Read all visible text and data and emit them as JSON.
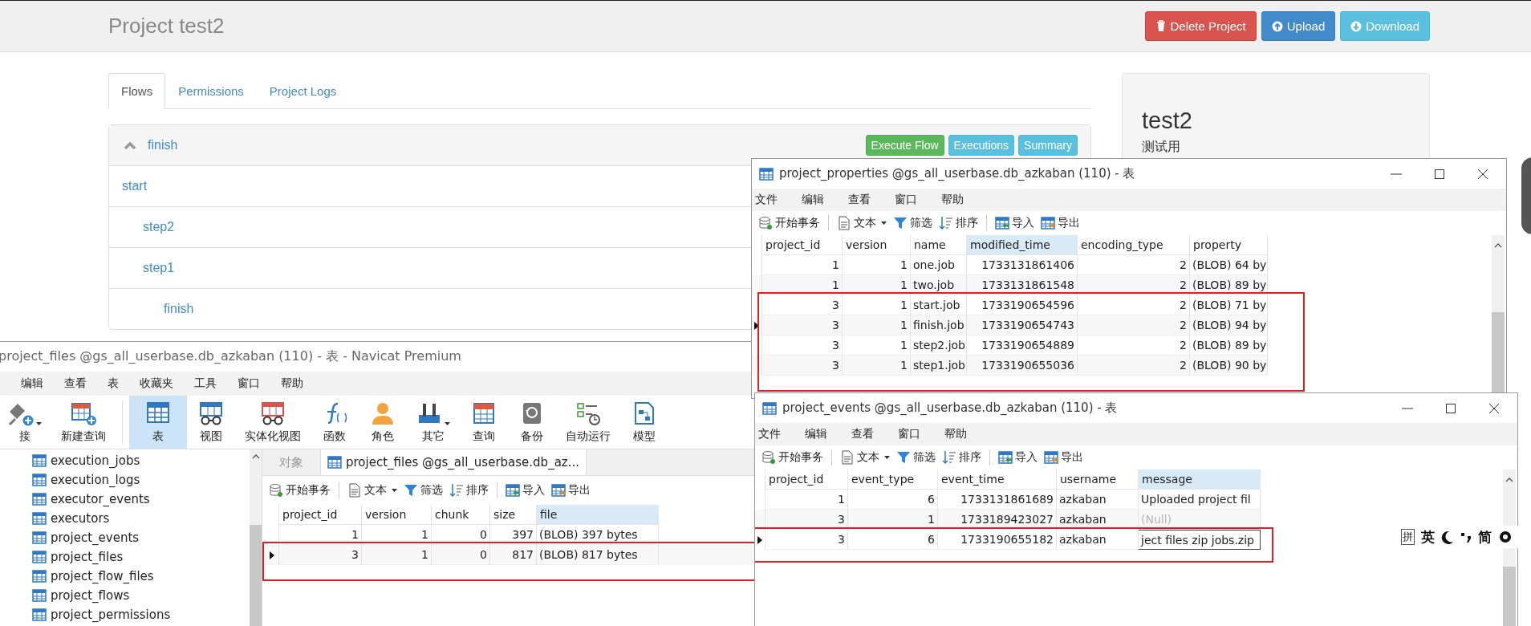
{
  "azkaban": {
    "title": "Project test2",
    "header_buttons": [
      {
        "label": "Delete Project",
        "kind": "danger"
      },
      {
        "label": "Upload",
        "kind": "primary"
      },
      {
        "label": "Download",
        "kind": "info"
      }
    ],
    "tabs": [
      {
        "label": "Flows",
        "selected": true
      },
      {
        "label": "Permissions",
        "selected": false
      },
      {
        "label": "Project Logs",
        "selected": false
      }
    ],
    "flow": {
      "name": "finish",
      "expanded": true,
      "buttons": [
        {
          "label": "Execute Flow",
          "kind": "success"
        },
        {
          "label": "Executions",
          "kind": "info"
        },
        {
          "label": "Summary",
          "kind": "info"
        }
      ],
      "nodes": [
        {
          "label": "start",
          "children": [
            {
              "label": "step2"
            },
            {
              "label": "step1",
              "children": [
                {
                  "label": "finish"
                }
              ]
            }
          ]
        }
      ]
    },
    "project_panel": {
      "name": "test2",
      "description": "测试用"
    }
  },
  "navicat_window": {
    "title": "project_files @gs_all_userbase.db_azkaban (110) - 表 - Navicat Premium",
    "menu": [
      "编辑",
      "查看",
      "表",
      "收藏夹",
      "工具",
      "窗口",
      "帮助"
    ],
    "toolbar": [
      {
        "label": "接",
        "kind": "connect",
        "selected": false,
        "dropdown": true
      },
      {
        "label": "新建查询",
        "kind": "newquery",
        "selected": false,
        "dropdown": false
      },
      {
        "label": "表",
        "kind": "table",
        "selected": true,
        "dropdown": false
      },
      {
        "label": "视图",
        "kind": "view",
        "selected": false,
        "dropdown": false
      },
      {
        "label": "实体化视图",
        "kind": "matview",
        "selected": false,
        "dropdown": false
      },
      {
        "label": "函数",
        "kind": "function",
        "selected": false,
        "dropdown": false
      },
      {
        "label": "角色",
        "kind": "user",
        "selected": false,
        "dropdown": false
      },
      {
        "label": "其它",
        "kind": "other",
        "selected": false,
        "dropdown": true
      },
      {
        "label": "查询",
        "kind": "query",
        "selected": false,
        "dropdown": false
      },
      {
        "label": "备份",
        "kind": "backup",
        "selected": false,
        "dropdown": false
      },
      {
        "label": "自动运行",
        "kind": "schedule",
        "selected": false,
        "dropdown": false
      },
      {
        "label": "模型",
        "kind": "model",
        "selected": false,
        "dropdown": false
      }
    ],
    "tree": [
      "execution_jobs",
      "execution_logs",
      "executor_events",
      "executors",
      "project_events",
      "project_files",
      "project_flow_files",
      "project_flows",
      "project_permissions"
    ],
    "tabs": [
      {
        "label": "对象",
        "selected": false
      },
      {
        "label": "project_files @gs_all_userbase.db_az...",
        "selected": true
      }
    ],
    "actions": [
      {
        "label": "开始事务",
        "kind": "begin",
        "dropdown": false
      },
      {
        "label": "文本",
        "kind": "text",
        "dropdown": true
      },
      {
        "label": "筛选",
        "kind": "filter",
        "dropdown": false
      },
      {
        "label": "排序",
        "kind": "sort",
        "dropdown": false
      },
      {
        "label": "导入",
        "kind": "import",
        "dropdown": false
      },
      {
        "label": "导出",
        "kind": "export",
        "dropdown": false
      }
    ],
    "columns": [
      {
        "label": "project_id",
        "kind": "number",
        "highlighted": false
      },
      {
        "label": "version",
        "kind": "number",
        "highlighted": false
      },
      {
        "label": "chunk",
        "kind": "number",
        "highlighted": false
      },
      {
        "label": "size",
        "kind": "number",
        "highlighted": false
      },
      {
        "label": "file",
        "kind": "text",
        "highlighted": true
      }
    ],
    "rows": [
      {
        "cells": [
          "1",
          "1",
          "0",
          "397",
          "(BLOB) 397 bytes"
        ],
        "selected": false,
        "outlined": false
      },
      {
        "cells": [
          "3",
          "1",
          "0",
          "817",
          "(BLOB) 817 bytes"
        ],
        "selected": true,
        "outlined": true
      }
    ]
  },
  "properties_window": {
    "title": "project_properties @gs_all_userbase.db_azkaban (110) - 表",
    "menu": [
      "文件",
      "编辑",
      "查看",
      "窗口",
      "帮助"
    ],
    "actions": [
      {
        "label": "开始事务",
        "kind": "begin",
        "dropdown": false
      },
      {
        "label": "文本",
        "kind": "text",
        "dropdown": true
      },
      {
        "label": "筛选",
        "kind": "filter",
        "dropdown": false
      },
      {
        "label": "排序",
        "kind": "sort",
        "dropdown": false
      },
      {
        "label": "导入",
        "kind": "import",
        "dropdown": false
      },
      {
        "label": "导出",
        "kind": "export",
        "dropdown": false
      }
    ],
    "columns": [
      {
        "label": "project_id",
        "kind": "number",
        "highlighted": false
      },
      {
        "label": "version",
        "kind": "number",
        "highlighted": false
      },
      {
        "label": "name",
        "kind": "text",
        "highlighted": false
      },
      {
        "label": "modified_time",
        "kind": "number",
        "highlighted": true
      },
      {
        "label": "encoding_type",
        "kind": "number",
        "highlighted": false
      },
      {
        "label": "property",
        "kind": "text",
        "highlighted": false
      }
    ],
    "rows": [
      {
        "cells": [
          "1",
          "1",
          "one.job",
          "1733131861406",
          "2",
          "(BLOB) 64 by"
        ],
        "selected": false,
        "outlined": false
      },
      {
        "cells": [
          "1",
          "1",
          "two.job",
          "1733131861548",
          "2",
          "(BLOB) 89 by"
        ],
        "selected": false,
        "outlined": false
      },
      {
        "cells": [
          "3",
          "1",
          "start.job",
          "1733190654596",
          "2",
          "(BLOB) 71 by"
        ],
        "selected": false,
        "outlined": true
      },
      {
        "cells": [
          "3",
          "1",
          "finish.job",
          "1733190654743",
          "2",
          "(BLOB) 94 by"
        ],
        "selected": true,
        "outlined": true
      },
      {
        "cells": [
          "3",
          "1",
          "step2.job",
          "1733190654889",
          "2",
          "(BLOB) 89 by"
        ],
        "selected": false,
        "outlined": true
      },
      {
        "cells": [
          "3",
          "1",
          "step1.job",
          "1733190655036",
          "2",
          "(BLOB) 90 by"
        ],
        "selected": false,
        "outlined": true
      }
    ]
  },
  "events_window": {
    "title": "project_events @gs_all_userbase.db_azkaban (110) - 表",
    "menu": [
      "文件",
      "编辑",
      "查看",
      "窗口",
      "帮助"
    ],
    "actions": [
      {
        "label": "开始事务",
        "kind": "begin",
        "dropdown": false
      },
      {
        "label": "文本",
        "kind": "text",
        "dropdown": true
      },
      {
        "label": "筛选",
        "kind": "filter",
        "dropdown": false
      },
      {
        "label": "排序",
        "kind": "sort",
        "dropdown": false
      },
      {
        "label": "导入",
        "kind": "import",
        "dropdown": false
      },
      {
        "label": "导出",
        "kind": "export",
        "dropdown": false
      }
    ],
    "columns": [
      {
        "label": "project_id",
        "kind": "number",
        "highlighted": false
      },
      {
        "label": "event_type",
        "kind": "number",
        "highlighted": false
      },
      {
        "label": "event_time",
        "kind": "number",
        "highlighted": false
      },
      {
        "label": "username",
        "kind": "text",
        "highlighted": false
      },
      {
        "label": "message",
        "kind": "text",
        "highlighted": true
      }
    ],
    "rows": [
      {
        "cells": [
          "1",
          "6",
          "1733131861689",
          "azkaban",
          "Uploaded project fil"
        ],
        "selected": false,
        "outlined": false
      },
      {
        "cells": [
          "3",
          "1",
          "1733189423027",
          "azkaban",
          {
            "text": "(Null)",
            "kind": "null"
          }
        ],
        "selected": false,
        "outlined": false
      },
      {
        "cells": [
          "3",
          "6",
          "1733190655182",
          "azkaban",
          {
            "text": "ject files zip jobs.zip",
            "kind": "editing"
          }
        ],
        "selected": true,
        "outlined": true
      }
    ]
  },
  "ime_bar": {
    "items": [
      {
        "kind": "boxed",
        "text": "拼"
      },
      {
        "kind": "text",
        "text": "英"
      },
      {
        "kind": "moon"
      },
      {
        "kind": "punct"
      },
      {
        "kind": "text",
        "text": "简"
      },
      {
        "kind": "gear"
      }
    ]
  }
}
